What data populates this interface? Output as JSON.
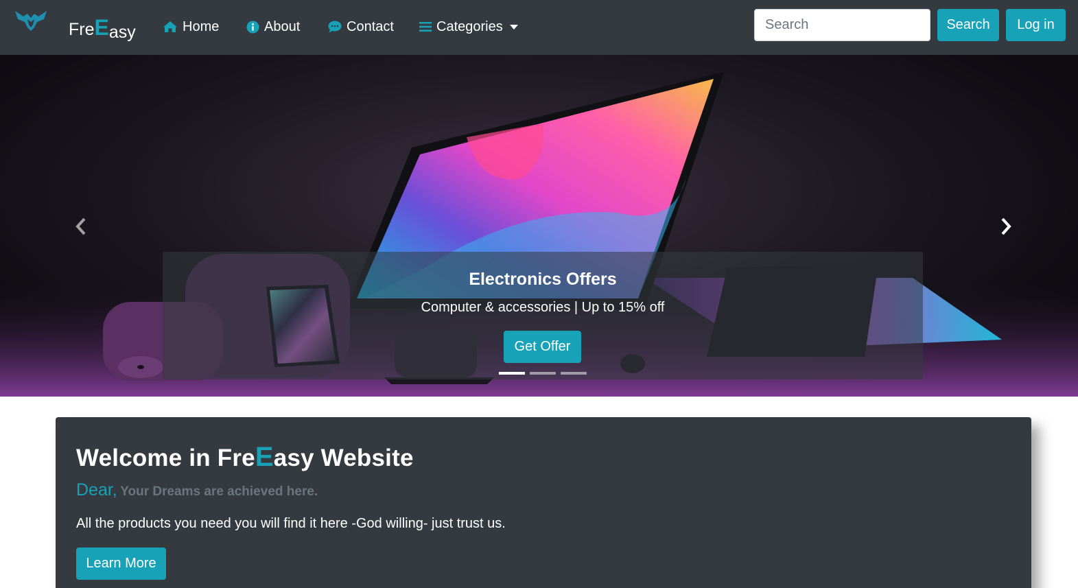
{
  "brand": {
    "name_prefix": "Fre",
    "name_accent": "E",
    "name_suffix": "asy",
    "logo_icon": "bird-icon"
  },
  "nav": {
    "items": [
      {
        "label": "Home",
        "icon": "home-icon"
      },
      {
        "label": "About",
        "icon": "info-icon"
      },
      {
        "label": "Contact",
        "icon": "chat-icon"
      },
      {
        "label": "Categories",
        "icon": "menu-icon"
      }
    ]
  },
  "search": {
    "placeholder": "Search",
    "button_label": "Search"
  },
  "login_label": "Log in",
  "carousel": {
    "caption_title": "Electronics Offers",
    "caption_text": "Computer & accessories | Up to 15% off",
    "button_label": "Get Offer",
    "slide_count": 3,
    "active_slide": 1
  },
  "jumbotron": {
    "title_prefix": "Welcome in Fre",
    "title_accent": "E",
    "title_suffix": "asy Website",
    "sub_dear": "Dear,",
    "sub_rest": "Your Dreams are achieved here.",
    "lead": "All the products you need you will find it here -God willing- just trust us.",
    "button_label": "Learn More"
  },
  "colors": {
    "navbar_bg": "#343a40",
    "accent": "#17a2b8",
    "muted": "#6c757d"
  }
}
